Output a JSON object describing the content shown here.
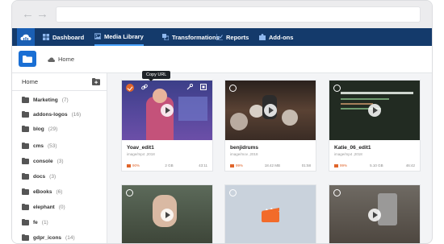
{
  "nav": {
    "items": [
      {
        "label": "Dashboard",
        "icon": "dashboard-icon"
      },
      {
        "label": "Media Library",
        "icon": "media-library-icon"
      },
      {
        "label": "Transformations",
        "icon": "transformations-icon"
      },
      {
        "label": "Reports",
        "icon": "reports-icon"
      },
      {
        "label": "Add-ons",
        "icon": "puzzle-icon"
      }
    ],
    "active": "Media Library"
  },
  "breadcrumb": {
    "home_label": "Home"
  },
  "sidebar": {
    "home_label": "Home",
    "folders": [
      {
        "name": "Marketing",
        "count": "(7)"
      },
      {
        "name": "addons-logos",
        "count": "(16)"
      },
      {
        "name": "blog",
        "count": "(29)"
      },
      {
        "name": "cms",
        "count": "(53)"
      },
      {
        "name": "console",
        "count": "(3)"
      },
      {
        "name": "docs",
        "count": "(3)"
      },
      {
        "name": "eBooks",
        "count": "(6)"
      },
      {
        "name": "elephant",
        "count": "(0)"
      },
      {
        "name": "fe",
        "count": "(1)"
      },
      {
        "name": "gdpr_icons",
        "count": "(14)"
      }
    ]
  },
  "tooltip": {
    "text": "Copy URL"
  },
  "cards": [
    {
      "title": "Yoav_edit1",
      "sub": "image/mp4 ,2018",
      "pct": "90%",
      "size": "2 GB",
      "duration": "43:11"
    },
    {
      "title": "benjidrums",
      "sub": "image/mov ,2018",
      "pct": "99%",
      "size": "18.42 MB",
      "duration": "01:58"
    },
    {
      "title": "Katie_06_edit1",
      "sub": "image/mp4 ,2018",
      "pct": "99%",
      "size": "5.10 GB",
      "duration": "46:42"
    }
  ],
  "colors": {
    "nav_bg": "#143a6b",
    "accent": "#1a6fd4",
    "orange": "#e0652b"
  }
}
